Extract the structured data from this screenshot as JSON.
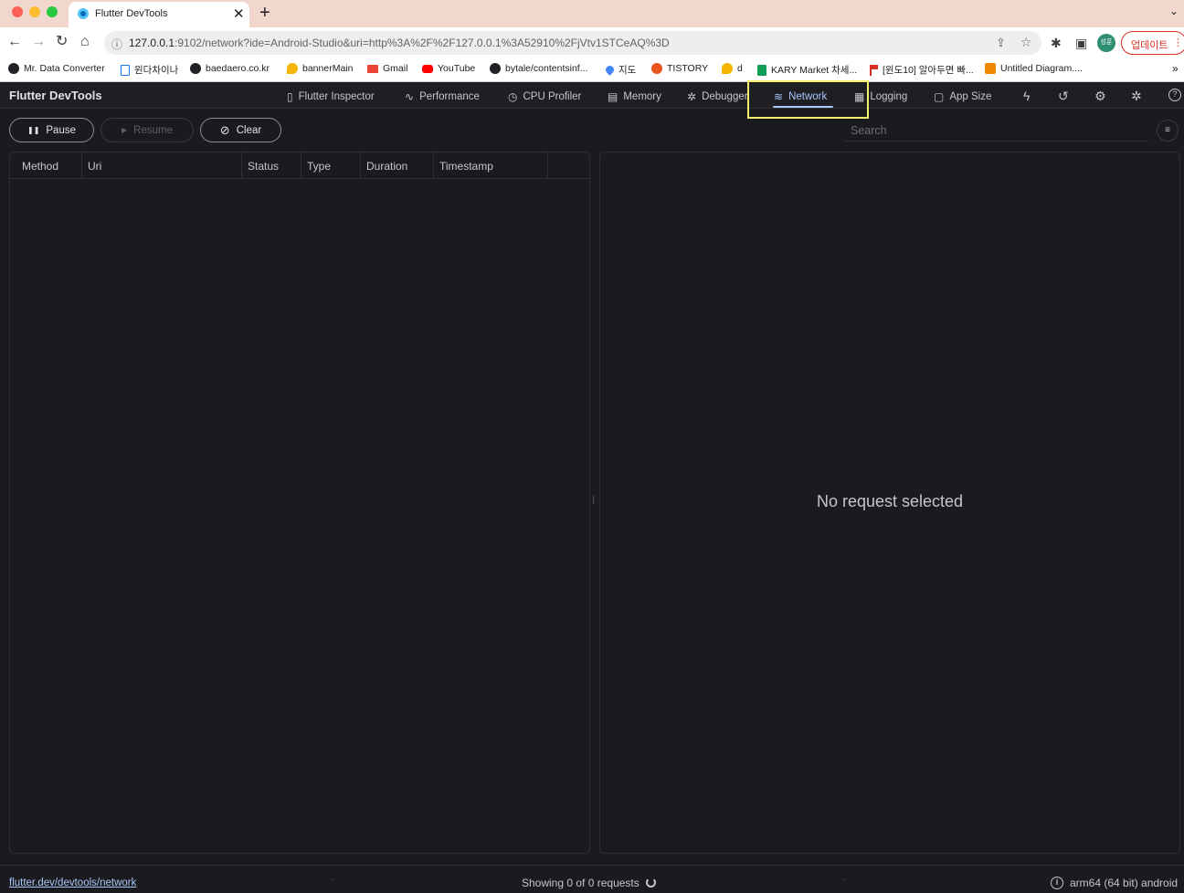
{
  "browser": {
    "tab": {
      "title": "Flutter DevTools",
      "close_glyph": "✕"
    },
    "new_tab_glyph": "+",
    "tabs_menu_glyph": "⌄",
    "url_host": "127.0.0.1",
    "url_rest": ":9102/network?ide=Android-Studio&uri=http%3A%2F%2F127.0.0.1%3A52910%2FjVtv1STCeAQ%3D",
    "nav": {
      "back": "←",
      "forward": "→",
      "reload": "↻",
      "home": "⌂",
      "site_info": "ⓘ",
      "share": "⇪",
      "star": "☆",
      "extensions": "✱",
      "sidepanel": "▣",
      "profile": "성훈",
      "menu": "⋮"
    },
    "update_label": "업데이트",
    "bookmarks": [
      {
        "label": "Mr. Data Converter",
        "icon": "globe-icon",
        "color": "#202124"
      },
      {
        "label": "윈다차이나",
        "icon": "page-icon",
        "color": "#1a73e8"
      },
      {
        "label": "baedaero.co.kr",
        "icon": "globe-icon",
        "color": "#202124"
      },
      {
        "label": "bannerMain",
        "icon": "firebase-icon",
        "color": "#f4b400"
      },
      {
        "label": "Gmail",
        "icon": "gmail-icon",
        "color": "#ea4335"
      },
      {
        "label": "YouTube",
        "icon": "youtube-icon",
        "color": "#ff0000"
      },
      {
        "label": "bytale/contentsinf...",
        "icon": "github-icon",
        "color": "#202124"
      },
      {
        "label": "지도",
        "icon": "map-pin-icon",
        "color": "#4285f4"
      },
      {
        "label": "TISTORY",
        "icon": "tistory-icon",
        "color": "#eb531f"
      },
      {
        "label": "d",
        "icon": "firebase-icon",
        "color": "#f4b400"
      },
      {
        "label": "KARY Market 차세...",
        "icon": "sheet-icon",
        "color": "#0f9d58"
      },
      {
        "label": "[윈도10] 알아두면 빠...",
        "icon": "flag-icon",
        "color": "#d93025"
      },
      {
        "label": "Untitled Diagram....",
        "icon": "diagram-icon",
        "color": "#f08705"
      }
    ],
    "bookmarks_overflow": "»"
  },
  "devtools": {
    "title": "Flutter DevTools",
    "tabs": [
      {
        "label": "Flutter Inspector",
        "icon": "phone-icon",
        "glyph": "▯",
        "active": false
      },
      {
        "label": "Performance",
        "icon": "pulse-icon",
        "glyph": "∿",
        "active": false
      },
      {
        "label": "CPU Profiler",
        "icon": "timer-icon",
        "glyph": "◷",
        "active": false
      },
      {
        "label": "Memory",
        "icon": "memory-icon",
        "glyph": "▤",
        "active": false
      },
      {
        "label": "Debugger",
        "icon": "bug-icon",
        "glyph": "✲",
        "active": false
      },
      {
        "label": "Network",
        "icon": "wifi-icon",
        "glyph": "≋",
        "active": true
      },
      {
        "label": "Logging",
        "icon": "clipboard-icon",
        "glyph": "▦",
        "active": false
      },
      {
        "label": "App Size",
        "icon": "file-size-icon",
        "glyph": "▢",
        "active": false
      }
    ],
    "actions": [
      {
        "name": "hot-reload-icon",
        "glyph": "ϟ"
      },
      {
        "name": "hot-restart-icon",
        "glyph": "↺"
      },
      {
        "name": "settings-icon",
        "glyph": "⚙"
      },
      {
        "name": "bug-report-icon",
        "glyph": "✲"
      },
      {
        "name": "help-icon",
        "glyph": "?"
      }
    ],
    "controls": {
      "pause": {
        "label": "Pause",
        "glyph": "❚❚"
      },
      "resume": {
        "label": "Resume",
        "glyph": "▶"
      },
      "clear": {
        "label": "Clear",
        "glyph": "⊘"
      },
      "search_placeholder": "Search",
      "filter_glyph": "≡"
    },
    "table": {
      "columns": [
        "Method",
        "Uri",
        "Status",
        "Type",
        "Duration",
        "Timestamp"
      ],
      "rows": []
    },
    "detail": {
      "empty_message": "No request selected"
    },
    "splitter_glyph": "||",
    "status_bar": {
      "docs_link": "flutter.dev/devtools/network",
      "dot": "·",
      "request_count": "Showing 0 of 0 requests",
      "device": "arm64 (64 bit) android"
    },
    "colors": {
      "accent": "#a8c7fa",
      "background": "#1b1b1f",
      "highlight": "#f7f06a"
    }
  }
}
